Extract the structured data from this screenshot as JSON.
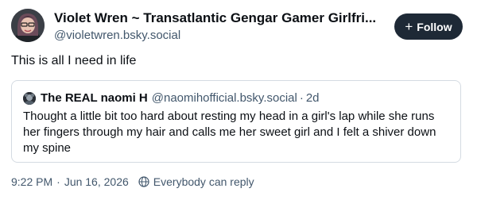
{
  "author": {
    "display_name": "Violet Wren ~ Transatlantic Gengar Gamer Girlfri...",
    "handle": "@violetwren.bsky.social"
  },
  "follow_button": {
    "label": "Follow",
    "icon": "plus-icon"
  },
  "post": {
    "text": "This is all I need in life"
  },
  "quote": {
    "author_name": "The REAL naomi H",
    "author_handle": "@naomihofficial.bsky.social",
    "separator": "·",
    "age": "2d",
    "text": "Thought a little bit too hard about resting my head in a girl's lap while she runs her fingers through my hair and calls me her sweet girl and I felt a shiver down my spine"
  },
  "meta": {
    "time": "9:22 PM",
    "separator": "·",
    "date": "Jun 16, 2026",
    "reply_setting": "Everybody can reply",
    "reply_icon": "globe-icon"
  },
  "colors": {
    "text": "#0b0f14",
    "muted": "#42576c",
    "follow_bg": "#1e2936",
    "border": "#d4dbe2"
  }
}
